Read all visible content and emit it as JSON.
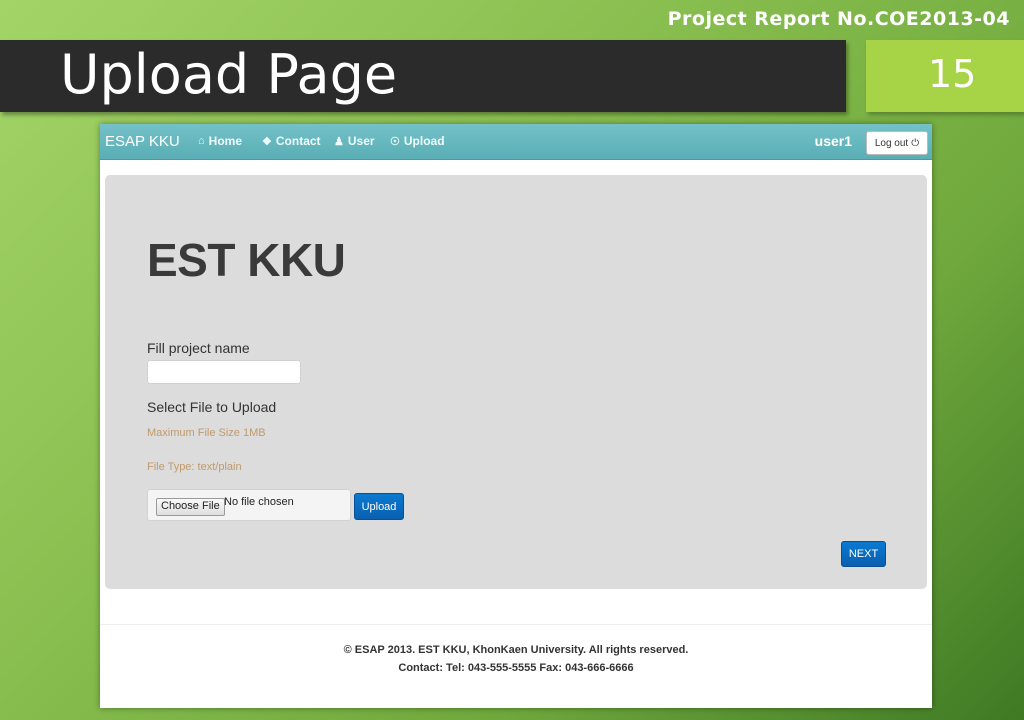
{
  "slide": {
    "report_no": "Project Report No.COE2013-04",
    "title": "Upload Page",
    "page_number": "15"
  },
  "navbar": {
    "brand": "ESAP KKU",
    "items": [
      {
        "label": "Home",
        "icon": "home-icon"
      },
      {
        "label": "Contact",
        "icon": "info-circle-icon"
      },
      {
        "label": "User",
        "icon": "user-icon"
      },
      {
        "label": "Upload",
        "icon": "upload-circle-icon"
      }
    ],
    "user": "user1",
    "logout_label": "Log out",
    "logout_icon": "power-icon"
  },
  "main": {
    "heading": "EST KKU",
    "project_label": "Fill project name",
    "project_value": "",
    "select_label": "Select File to Upload",
    "max_size_note": "Maximum File Size 1MB",
    "file_type_note": "File Type: text/plain",
    "choose_file_label": "Choose File",
    "no_file_text": "No file chosen",
    "upload_label": "Upload",
    "next_label": "NEXT"
  },
  "footer": {
    "line1": "© ESAP 2013. EST KKU, KhonKaen University. All rights reserved.",
    "line2": "Contact: Tel: 043-555-5555 Fax: 043-666-6666"
  },
  "colors": {
    "navbar": "#5aaeb6",
    "primary_button": "#0a6ac0",
    "note_text": "#c09a6b",
    "title_bar": "#2b2b2b",
    "page_num_box": "#a7d447"
  }
}
